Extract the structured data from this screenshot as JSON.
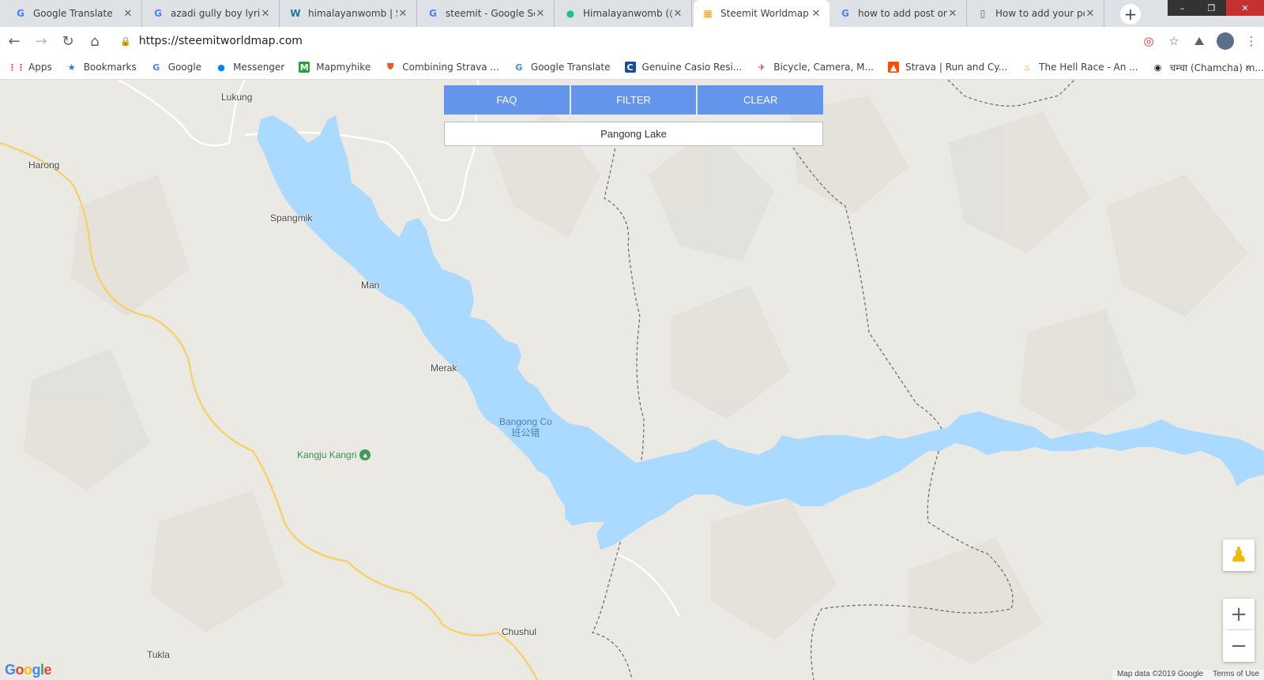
{
  "browser": {
    "tabs": [
      {
        "title": "Google Translate",
        "icon": "google-translate-icon",
        "active": false
      },
      {
        "title": "azadi gully boy lyrics",
        "icon": "google-g-icon",
        "active": false
      },
      {
        "title": "himalayanwomb | St",
        "icon": "wordpress-icon",
        "active": false
      },
      {
        "title": "steemit - Google Sea",
        "icon": "google-g-icon",
        "active": false
      },
      {
        "title": "Himalayanwomb (@",
        "icon": "steemit-icon",
        "active": false
      },
      {
        "title": "Steemit Worldmap",
        "icon": "worldmap-icon",
        "active": true
      },
      {
        "title": "how to add post on",
        "icon": "google-g-icon",
        "active": false
      },
      {
        "title": "How to add your po",
        "icon": "document-icon",
        "active": false
      }
    ],
    "url": "https://steemitworldmap.com",
    "bookmarks": [
      {
        "label": "Apps",
        "icon": "apps-grid-icon"
      },
      {
        "label": "Bookmarks",
        "icon": "star-icon"
      },
      {
        "label": "Google",
        "icon": "google-g-icon"
      },
      {
        "label": "Messenger",
        "icon": "messenger-icon"
      },
      {
        "label": "Mapmyhike",
        "icon": "mapmyhike-icon"
      },
      {
        "label": "Combining Strava ...",
        "icon": "shield-icon"
      },
      {
        "label": "Google Translate",
        "icon": "google-translate-icon"
      },
      {
        "label": "Genuine Casio Resi...",
        "icon": "casio-icon"
      },
      {
        "label": "Bicycle, Camera, M...",
        "icon": "bicycle-icon"
      },
      {
        "label": "Strava | Run and Cy...",
        "icon": "strava-icon"
      },
      {
        "label": "The Hell Race - An ...",
        "icon": "flame-icon"
      },
      {
        "label": "चम्चा (Chamcha) m...",
        "icon": "chamcha-icon"
      }
    ]
  },
  "map_ui": {
    "buttons": {
      "faq": "FAQ",
      "filter": "FILTER",
      "clear": "CLEAR"
    },
    "search_value": "Pangong Lake",
    "attribution": {
      "data": "Map data ©2019 Google",
      "terms": "Terms of Use"
    },
    "logo": "Google"
  },
  "map": {
    "places": [
      {
        "name": "Lukung"
      },
      {
        "name": "Harong"
      },
      {
        "name": "Spangmik"
      },
      {
        "name": "Man"
      },
      {
        "name": "Merak"
      },
      {
        "name": "Chushul"
      },
      {
        "name": "Tukla"
      }
    ],
    "lake": {
      "name": "Bangong Co",
      "name_local": "班公错"
    },
    "peak": {
      "name": "Kangju Kangri"
    },
    "colors": {
      "water": "#aadaff",
      "land": "#ebe9e3",
      "road": "#f5d26b",
      "button": "#6495ed"
    }
  }
}
